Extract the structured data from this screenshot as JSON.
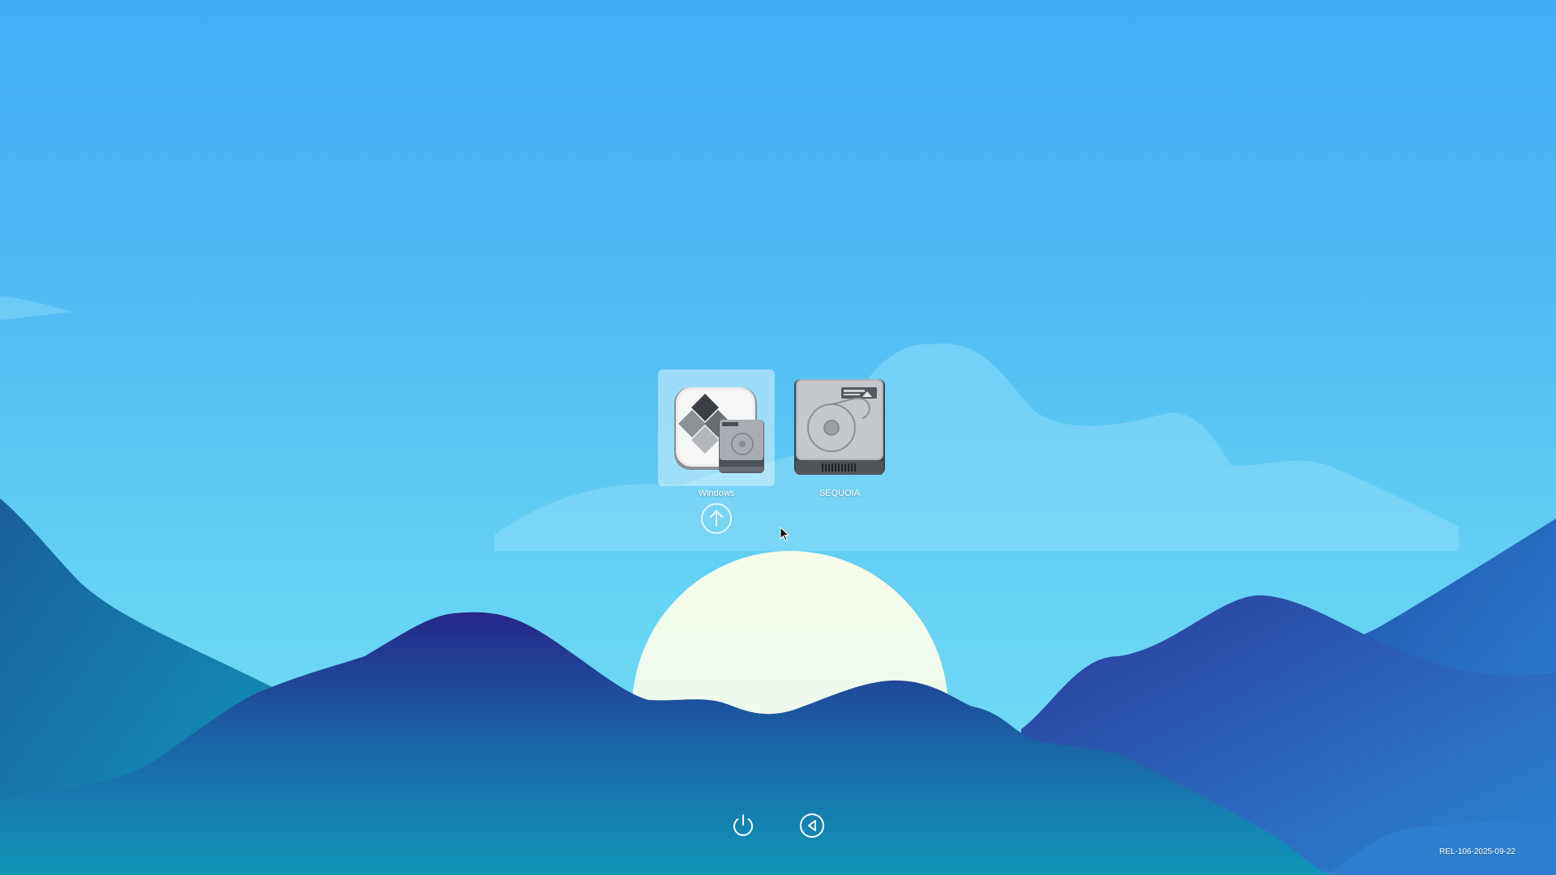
{
  "boot_picker": {
    "volumes": [
      {
        "label": "Windows",
        "icon": "bootcamp-windows-disk-icon",
        "selected": true
      },
      {
        "label": "SEQUOIA",
        "icon": "internal-hard-drive-icon",
        "selected": false
      }
    ],
    "boot_button_icon": "arrow-up-circle-icon"
  },
  "bottom_controls": {
    "shutdown_icon": "power-icon",
    "restart_icon": "back-arrow-circle-icon"
  },
  "release_tag": "REL-106-2025-09-22",
  "colors": {
    "sky_top": "#41aef6",
    "sky_bottom": "#74dcf3",
    "mountain_dark": "#25288a",
    "mountain_teal": "#1096b8",
    "sun": "#f2fbe8",
    "selection_highlight": "rgba(255,255,255,0.42)"
  }
}
